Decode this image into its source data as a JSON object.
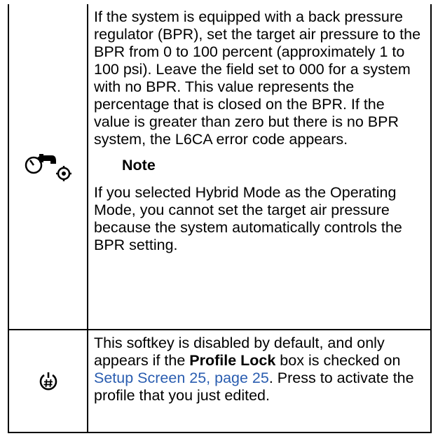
{
  "rows": [
    {
      "icon": "pressure-gauge-settings-icon",
      "paragraph": "If the system is equipped with a back pressure regulator (BPR), set the target air pressure to the BPR from 0 to 100 percent (approximately 1 to 100 psi). Leave the field set to 000 for a system with no BPR. This value represents the percentage that is closed on the BPR. If the value is greater than zero but there is no BPR system, the L6CA error code appears.",
      "note_heading": "Note",
      "note_text": "If you selected Hybrid Mode as the Operating Mode, you cannot set the target air pressure because the system automatically controls the BPR setting."
    },
    {
      "icon": "profile-activate-icon",
      "text_before": "This softkey is disabled by default, and only appears if the ",
      "bold_term": "Profile Lock",
      "text_middle": " box is checked on ",
      "link_text": "Setup Screen 25, page 25",
      "text_after": ". Press to activate the profile that you just edited."
    }
  ]
}
